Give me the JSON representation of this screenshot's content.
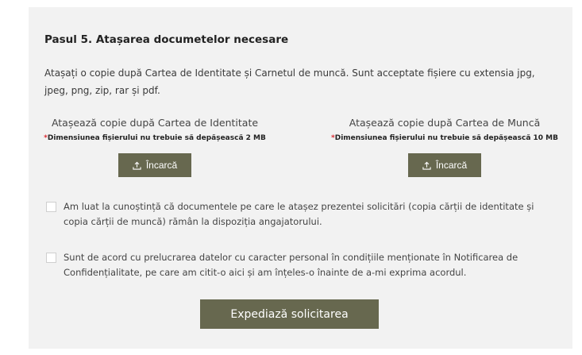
{
  "step": {
    "title": "Pasul 5. Atașarea documetelor necesare",
    "description": "Atașați o copie după Cartea de Identitate și Carnetul de muncă. Sunt acceptate fișiere cu extensia jpg, jpeg, png, zip, rar și pdf."
  },
  "uploads": [
    {
      "title": "Atașează copie după Cartea de Identitate",
      "required_mark": "*",
      "size_note": "Dimensiunea fișierului nu trebuie să depășească 2 MB",
      "button_label": "Încarcă",
      "button_icon": "upload-icon"
    },
    {
      "title": "Atașează copie după Cartea de Muncă",
      "required_mark": "*",
      "size_note": "Dimensiunea fișierului nu trebuie să depășească 10 MB",
      "button_label": "Încarcă",
      "button_icon": "upload-icon"
    }
  ],
  "consents": [
    {
      "text": "Am luat la cunoștință că documentele pe care le atașez prezentei solicitări (copia cărții de identitate și copia cărții de muncă) rămân la dispoziția angajatorului.",
      "checked": false
    },
    {
      "text": "Sunt de acord cu prelucrarea datelor cu caracter personal în condițiile menționate în Notificarea de Confidențialitate, pe care am citit-o aici și am înțeles-o înainte de a-mi exprima acordul.",
      "checked": false
    }
  ],
  "submit": {
    "label": "Expediază solicitarea"
  },
  "colors": {
    "panel_bg": "#f2f2f2",
    "button_bg": "#67684f",
    "required": "#d9282f"
  }
}
